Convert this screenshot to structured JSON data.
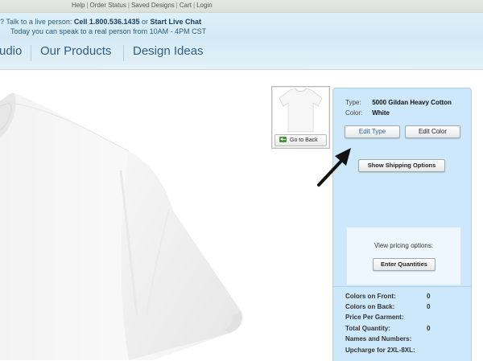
{
  "top_links": {
    "help": "Help",
    "order_status": "Order Status",
    "saved_designs": "Saved Designs",
    "cart": "Cart",
    "login": "Login",
    "separator": "|"
  },
  "contact": {
    "prefix": "? Talk to a live person:",
    "phone": "Cell 1.800.536.1435",
    "or": "or",
    "chat": "Start Live Chat",
    "hours": "Today you can speak to a real person from 10AM - 4PM CST"
  },
  "nav": {
    "studio_fragment": "udio",
    "our_products": "Our Products",
    "design_ideas": "Design Ideas"
  },
  "thumbnail": {
    "back_label": "Go to Back"
  },
  "product": {
    "type_label": "Type:",
    "type_value": "5000 Gildan Heavy Cotton",
    "color_label": "Color:",
    "color_value": "White"
  },
  "buttons": {
    "edit_type": "Edit Type",
    "edit_color": "Edit Color",
    "show_shipping": "Show Shipping Options",
    "enter_quantities": "Enter Quantities"
  },
  "pricing": {
    "label": "View pricing options:"
  },
  "stats": [
    {
      "label": "Colors on Front:",
      "value": "0"
    },
    {
      "label": "Colors on Back:",
      "value": "0"
    },
    {
      "label": "Price Per Garment:",
      "value": ""
    },
    {
      "label": "Total Quantity:",
      "value": "0"
    },
    {
      "label": "Names and Numbers:",
      "value": ""
    },
    {
      "label": "Upcharge for 2XL-8XL:",
      "value": ""
    }
  ],
  "colors": {
    "panel_bg": "#cde8fa",
    "nav_text": "#2f5f80",
    "back_arrow": "#3f9b2c"
  }
}
